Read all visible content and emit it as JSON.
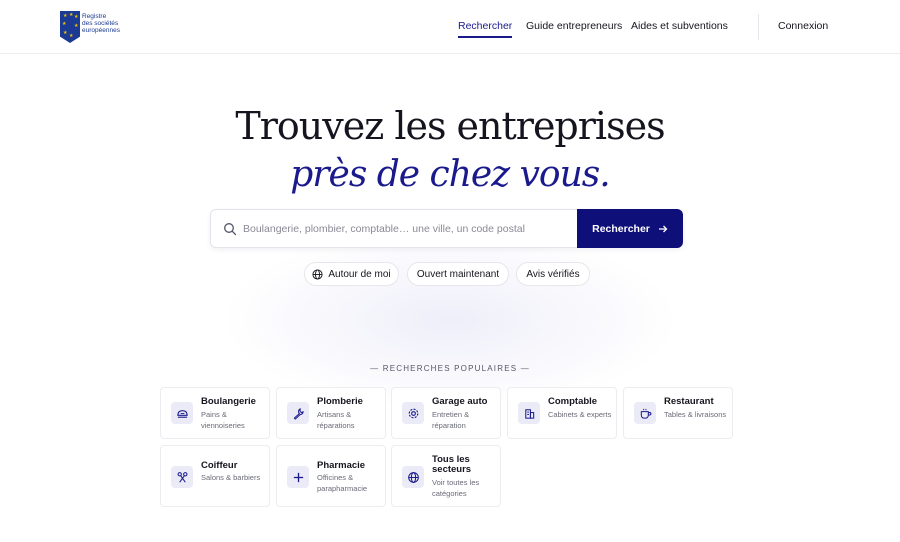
{
  "brand": {
    "logo_text": [
      "Registre",
      "des sociétés",
      "européennes"
    ],
    "primary_color": "#1a1a8c"
  },
  "nav": {
    "items": [
      {
        "label": "Rechercher",
        "active": true
      },
      {
        "label": "Guide entrepreneurs",
        "active": false
      },
      {
        "label": "Aides et subventions",
        "active": false
      }
    ],
    "login": "Connexion"
  },
  "hero": {
    "title_line1": "Trouvez les entreprises",
    "title_line2": "près de chez vous."
  },
  "search": {
    "placeholder": "Boulangerie, plombier, comptable… une ville, un code postal",
    "value": "",
    "button_label": "Rechercher"
  },
  "chips": [
    {
      "label": "Autour de moi",
      "icon": "globe-icon"
    },
    {
      "label": "Ouvert maintenant"
    },
    {
      "label": "Avis vérifiés"
    }
  ],
  "popular": {
    "title": "— RECHERCHES POPULAIRES —",
    "items": [
      {
        "title": "Boulangerie",
        "subtitle": "Pains & viennoiseries",
        "icon": "bread-icon"
      },
      {
        "title": "Plomberie",
        "subtitle": "Artisans & réparations",
        "icon": "wrench-icon"
      },
      {
        "title": "Garage auto",
        "subtitle": "Entretien & réparation",
        "icon": "gear-icon"
      },
      {
        "title": "Comptable",
        "subtitle": "Cabinets & experts",
        "icon": "building-icon"
      },
      {
        "title": "Restaurant",
        "subtitle": "Tables & livraisons",
        "icon": "cup-icon"
      },
      {
        "title": "Coiffeur",
        "subtitle": "Salons & barbiers",
        "icon": "scissors-icon"
      },
      {
        "title": "Pharmacie",
        "subtitle": "Officines & parapharmacie",
        "icon": "cross-icon"
      },
      {
        "title": "Tous les secteurs",
        "subtitle": "Voir toutes les catégories",
        "icon": "globe-icon"
      }
    ]
  }
}
